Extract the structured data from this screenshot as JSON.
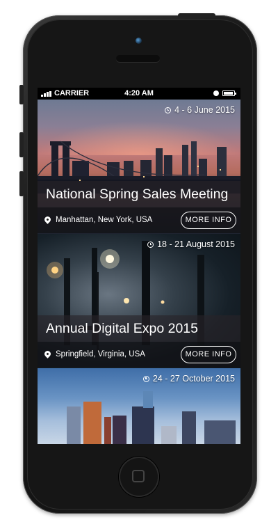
{
  "status_bar": {
    "carrier": "CARRIER",
    "time": "4:20 AM"
  },
  "events": [
    {
      "date": "4 - 6 June 2015",
      "title": "National Spring Sales Meeting",
      "location": "Manhattan, New York, USA",
      "button_label": "MORE INFO"
    },
    {
      "date": "18 - 21 August 2015",
      "title": "Annual Digital Expo 2015",
      "location": "Springfield, Virginia, USA",
      "button_label": "MORE INFO"
    },
    {
      "date": "24 - 27 October 2015"
    }
  ]
}
